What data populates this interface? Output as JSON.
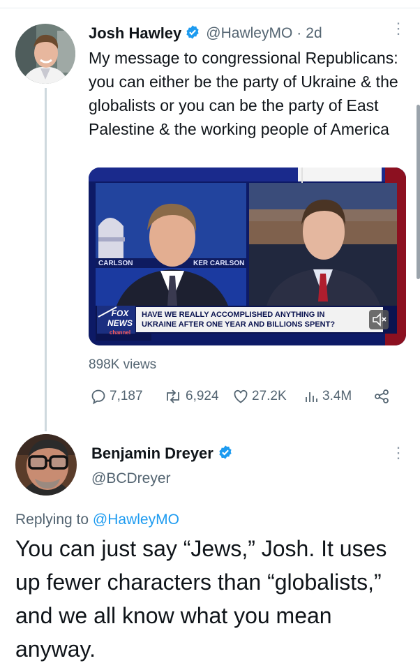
{
  "tweet": {
    "author_name": "Josh Hawley",
    "handle": "@HawleyMO",
    "separator": "·",
    "time": "2d",
    "text": "My message to congressional Republicans: you can either be the party of Ukraine & the globalists or you can be the party of East Palestine & the working people of America",
    "views_label": "898K views",
    "video": {
      "name_strip_left": "CARLSON",
      "name_strip_right": "KER CARLSON",
      "chyron_line1": "HAVE WE REALLY ACCOMPLISHED ANYTHING IN",
      "chyron_line2": "UKRAINE AFTER ONE YEAR AND BILLIONS SPENT?",
      "logo_top": "FOX",
      "logo_bottom": "NEWS",
      "logo_channel": "channel",
      "mute_icon": "speaker-muted-icon"
    },
    "stats": {
      "replies": "7,187",
      "retweets": "6,924",
      "likes": "27.2K",
      "views": "3.4M"
    }
  },
  "reply": {
    "author_name": "Benjamin Dreyer",
    "handle": "@BCDreyer",
    "replying_prefix": "Replying to",
    "replying_handle": "@HawleyMO",
    "text": "You can just say “Jews,” Josh. It uses up fewer characters than “globalists,” and we all know what you mean anyway."
  },
  "colors": {
    "accent": "#1d9bf0",
    "text": "#0f1419",
    "muted": "#536471",
    "thread_line": "#cfd9de"
  }
}
